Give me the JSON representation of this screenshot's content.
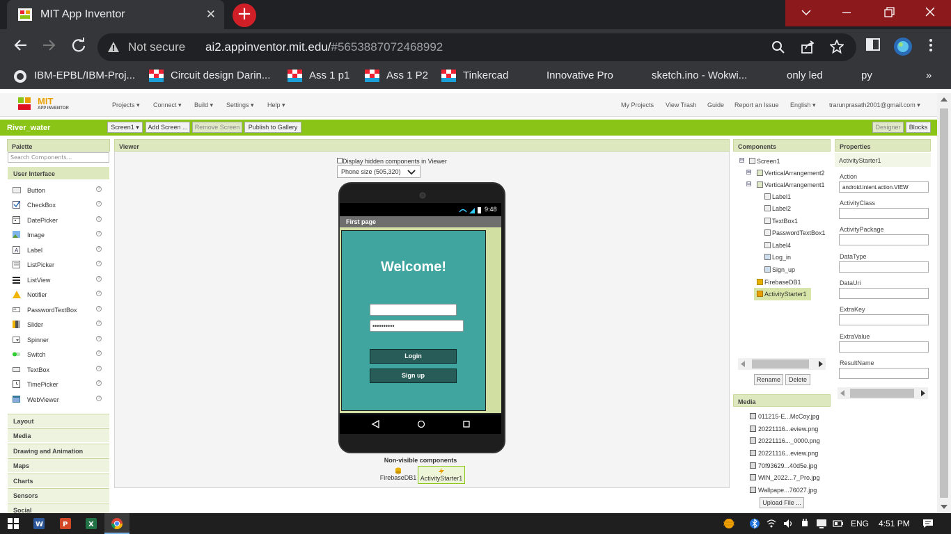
{
  "browser": {
    "tab_title": "MIT App Inventor",
    "close_label": "✕",
    "new_tab_label": "+",
    "not_secure": "Not secure",
    "url_host": "ai2.appinventor.mit.edu/",
    "url_path": "#5653887072468992",
    "bookmarks": [
      "IBM-EPBL/IBM-Proj...",
      "Circuit design Darin...",
      "Ass 1 p1",
      "Ass 1 P2",
      "Tinkercad",
      "Innovative Pro",
      "sketch.ino - Wokwi...",
      "only led",
      "py"
    ],
    "bookmarks_more": "»"
  },
  "app": {
    "logo_mit": "MIT",
    "logo_sub": "APP INVENTOR",
    "menus": [
      "Projects ▾",
      "Connect ▾",
      "Build ▾",
      "Settings ▾",
      "Help ▾"
    ],
    "right_links": [
      "My Projects",
      "View Trash",
      "Guide",
      "Report an Issue",
      "English ▾",
      "trarunprasath2001@gmail.com ▾"
    ],
    "project_name": "River_water",
    "screen_select": "Screen1 ▾",
    "add_screen": "Add Screen ...",
    "remove_screen": "Remove Screen",
    "publish": "Publish to Gallery",
    "designer": "Designer",
    "blocks": "Blocks"
  },
  "palette": {
    "title": "Palette",
    "search_placeholder": "Search Components...",
    "category": "User Interface",
    "items": [
      "Button",
      "CheckBox",
      "DatePicker",
      "Image",
      "Label",
      "ListPicker",
      "ListView",
      "Notifier",
      "PasswordTextBox",
      "Slider",
      "Spinner",
      "Switch",
      "TextBox",
      "TimePicker",
      "WebViewer"
    ],
    "help": "?",
    "categories": [
      "Layout",
      "Media",
      "Drawing and Animation",
      "Maps",
      "Charts",
      "Sensors",
      "Social"
    ]
  },
  "viewer": {
    "title": "Viewer",
    "hidden_label": "Display hidden components in Viewer",
    "phone_size": "Phone size (505,320)",
    "time": "9:48",
    "screen_title": "First page",
    "welcome": "Welcome!",
    "password_dots": "••••••••••",
    "login": "Login",
    "signup": "Sign up",
    "nonvisible_title": "Non-visible components",
    "nonvisible": [
      "FirebaseDB1",
      "ActivityStarter1"
    ]
  },
  "components": {
    "title": "Components",
    "expand": "⊟",
    "collapse": "⊞",
    "screen": "Screen1",
    "va2": "VerticalArrangement2",
    "va1": "VerticalArrangement1",
    "children": [
      "Label1",
      "Label2",
      "TextBox1",
      "PasswordTextBox1",
      "Label4",
      "Log_in",
      "Sign_up"
    ],
    "firebase": "FirebaseDB1",
    "activity": "ActivityStarter1",
    "rename": "Rename",
    "delete": "Delete"
  },
  "media": {
    "title": "Media",
    "files": [
      "011215-E...McCoy.jpg",
      "20221116...eview.png",
      "20221116..._0000.png",
      "20221116...eview.png",
      "70f93629...40d5e.jpg",
      "WIN_2022...7_Pro.jpg",
      "Wallpape...76027.jpg"
    ],
    "upload": "Upload File ..."
  },
  "properties": {
    "title": "Properties",
    "component": "ActivityStarter1",
    "fields": [
      {
        "label": "Action",
        "value": "android.intent.action.VIEW"
      },
      {
        "label": "ActivityClass",
        "value": ""
      },
      {
        "label": "ActivityPackage",
        "value": ""
      },
      {
        "label": "DataType",
        "value": ""
      },
      {
        "label": "DataUri",
        "value": ""
      },
      {
        "label": "ExtraKey",
        "value": ""
      },
      {
        "label": "ExtraValue",
        "value": ""
      },
      {
        "label": "ResultName",
        "value": ""
      }
    ]
  },
  "taskbar": {
    "lang": "ENG",
    "time": "4:51 PM"
  },
  "colors": {
    "green_bar": "#8ac416",
    "phone_bg": "#40a59e",
    "phone_button": "#275c58"
  }
}
